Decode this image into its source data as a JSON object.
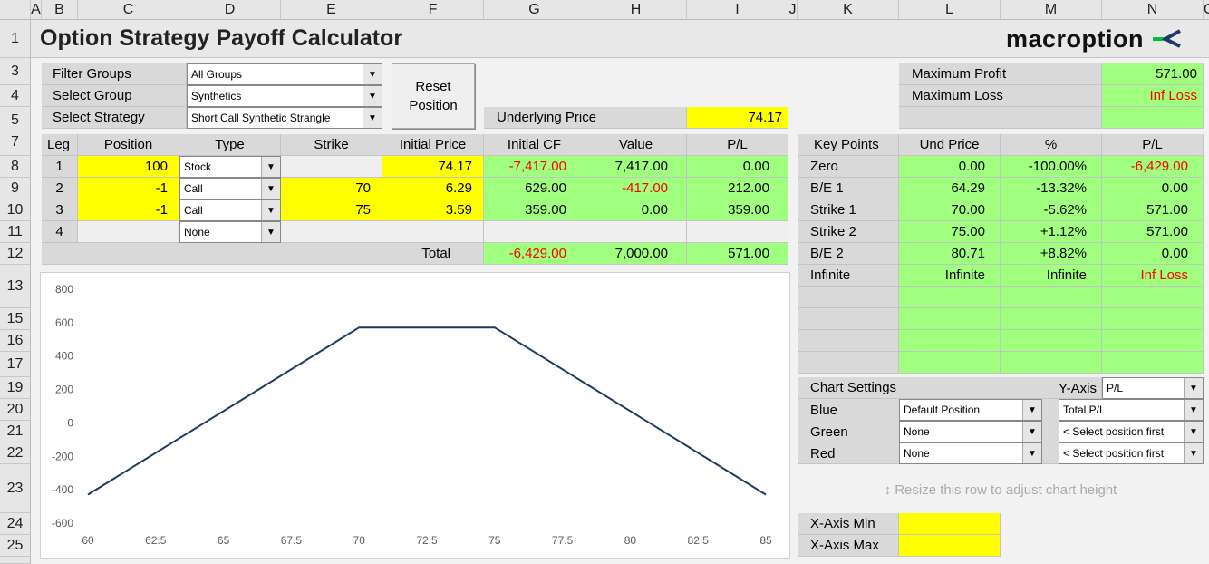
{
  "columns": [
    "A",
    "B",
    "C",
    "D",
    "E",
    "F",
    "G",
    "H",
    "I",
    "J",
    "K",
    "L",
    "M",
    "N",
    "O"
  ],
  "rows": [
    "1",
    "3",
    "4",
    "5",
    "7",
    "8",
    "9",
    "10",
    "11",
    "12",
    "13",
    "15",
    "16",
    "17",
    "19",
    "20",
    "21",
    "22",
    "23",
    "24",
    "25"
  ],
  "title": "Option Strategy Payoff Calculator",
  "logo": {
    "text": "macroption",
    "colors": [
      "#00c040",
      "#1f3864"
    ]
  },
  "selectors": {
    "filter_label": "Filter Groups",
    "filter_value": "All Groups",
    "group_label": "Select Group",
    "group_value": "Synthetics",
    "strategy_label": "Select Strategy",
    "strategy_value": "Short Call Synthetic Strangle"
  },
  "reset_button": {
    "line1": "Reset",
    "line2": "Position"
  },
  "underlying": {
    "label": "Underlying Price",
    "value": "74.17"
  },
  "summary": {
    "max_profit_label": "Maximum Profit",
    "max_profit": "571.00",
    "max_loss_label": "Maximum Loss",
    "max_loss": "Inf Loss"
  },
  "legs": {
    "headers": [
      "Leg",
      "Position",
      "Type",
      "Strike",
      "Initial Price",
      "Initial CF",
      "Value",
      "P/L"
    ],
    "rows": [
      {
        "leg": "1",
        "position": "100",
        "type": "Stock",
        "strike": "",
        "price": "74.17",
        "cf": "-7,417.00",
        "value": "7,417.00",
        "pl": "0.00"
      },
      {
        "leg": "2",
        "position": "-1",
        "type": "Call",
        "strike": "70",
        "price": "6.29",
        "cf": "629.00",
        "value": "-417.00",
        "pl": "212.00"
      },
      {
        "leg": "3",
        "position": "-1",
        "type": "Call",
        "strike": "75",
        "price": "3.59",
        "cf": "359.00",
        "value": "0.00",
        "pl": "359.00"
      },
      {
        "leg": "4",
        "position": "",
        "type": "None",
        "strike": "",
        "price": "",
        "cf": "",
        "value": "",
        "pl": ""
      }
    ],
    "total_label": "Total",
    "total_cf": "-6,429.00",
    "total_value": "7,000.00",
    "total_pl": "571.00"
  },
  "key_points": {
    "headers": [
      "Key Points",
      "Und Price",
      "%",
      "P/L"
    ],
    "rows": [
      {
        "name": "Zero",
        "price": "0.00",
        "pct": "-100.00%",
        "pl": "-6,429.00"
      },
      {
        "name": "B/E 1",
        "price": "64.29",
        "pct": "-13.32%",
        "pl": "0.00"
      },
      {
        "name": "Strike 1",
        "price": "70.00",
        "pct": "-5.62%",
        "pl": "571.00"
      },
      {
        "name": "Strike 2",
        "price": "75.00",
        "pct": "+1.12%",
        "pl": "571.00"
      },
      {
        "name": "B/E 2",
        "price": "80.71",
        "pct": "+8.82%",
        "pl": "0.00"
      },
      {
        "name": "Infinite",
        "price": "Infinite",
        "pct": "Infinite",
        "pl": "Inf Loss"
      }
    ]
  },
  "chart_settings": {
    "title": "Chart Settings",
    "yaxis_label": "Y-Axis",
    "yaxis_value": "P/L",
    "blue_label": "Blue",
    "blue_pos": "Default Position",
    "blue_line": "Total P/L",
    "green_label": "Green",
    "green_pos": "None",
    "green_line": "< Select position first",
    "red_label": "Red",
    "red_pos": "None",
    "red_line": "< Select position first",
    "resize_hint": "Resize this row to adjust chart height",
    "xmin_label": "X-Axis Min",
    "xmin": "",
    "xmax_label": "X-Axis Max",
    "xmax": ""
  },
  "chart_data": {
    "type": "line",
    "x": [
      60,
      64.29,
      70,
      75,
      80.71,
      85
    ],
    "y": [
      -429,
      0,
      571,
      571,
      0,
      -429
    ],
    "xlim": [
      60,
      85
    ],
    "ylim": [
      -600,
      800
    ],
    "xticks": [
      "60",
      "62.5",
      "65",
      "67.5",
      "70",
      "72.5",
      "75",
      "77.5",
      "80",
      "82.5",
      "85"
    ],
    "yticks": [
      "800",
      "600",
      "400",
      "200",
      "0",
      "-200",
      "-400",
      "-600"
    ],
    "line_color": "#1f3864",
    "grid": false
  }
}
